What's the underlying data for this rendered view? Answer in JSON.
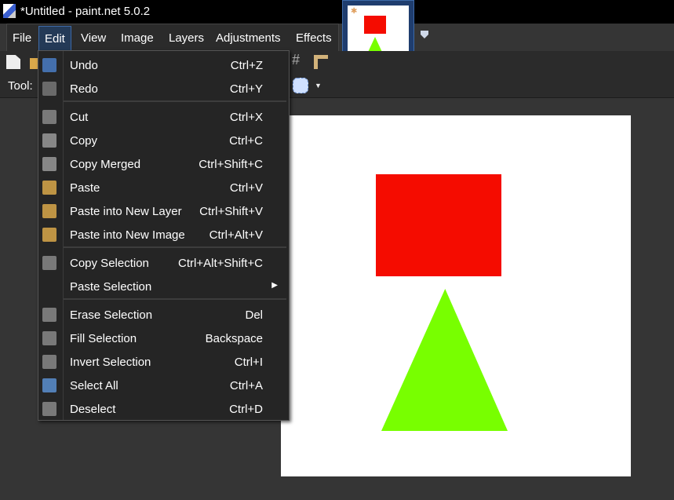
{
  "window": {
    "title": "*Untitled - paint.net 5.0.2"
  },
  "menubar": [
    "File",
    "Edit",
    "View",
    "Image",
    "Layers",
    "Adjustments",
    "Effects"
  ],
  "toolbar": {
    "tool_label": "Tool:"
  },
  "colors": {
    "red": "#f50c00",
    "green": "#78ff00",
    "accent": "#3d6aa8"
  },
  "edit_menu": [
    {
      "label": "Undo",
      "shortcut": "Ctrl+Z",
      "icon": "undo-icon"
    },
    {
      "label": "Redo",
      "shortcut": "Ctrl+Y",
      "icon": "redo-icon"
    },
    {
      "label": "Cut",
      "shortcut": "Ctrl+X",
      "icon": "scissors-icon"
    },
    {
      "label": "Copy",
      "shortcut": "Ctrl+C",
      "icon": "copy-icon"
    },
    {
      "label": "Copy Merged",
      "shortcut": "Ctrl+Shift+C",
      "icon": "copy-merged-icon"
    },
    {
      "label": "Paste",
      "shortcut": "Ctrl+V",
      "icon": "paste-icon"
    },
    {
      "label": "Paste into New Layer",
      "shortcut": "Ctrl+Shift+V",
      "icon": "paste-layer-icon"
    },
    {
      "label": "Paste into New Image",
      "shortcut": "Ctrl+Alt+V",
      "icon": "paste-image-icon"
    },
    {
      "label": "Copy Selection",
      "shortcut": "Ctrl+Alt+Shift+C",
      "icon": "copy-selection-icon"
    },
    {
      "label": "Paste Selection",
      "shortcut": "",
      "icon": "",
      "submenu": true
    },
    {
      "label": "Erase Selection",
      "shortcut": "Del",
      "icon": "erase-icon"
    },
    {
      "label": "Fill Selection",
      "shortcut": "Backspace",
      "icon": "fill-icon"
    },
    {
      "label": "Invert Selection",
      "shortcut": "Ctrl+I",
      "icon": "invert-icon"
    },
    {
      "label": "Select All",
      "shortcut": "Ctrl+A",
      "icon": "select-all-icon"
    },
    {
      "label": "Deselect",
      "shortcut": "Ctrl+D",
      "icon": "deselect-icon"
    }
  ]
}
